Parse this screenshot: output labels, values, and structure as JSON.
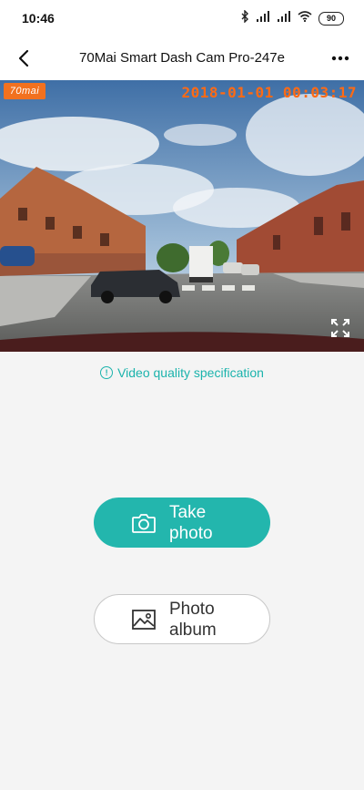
{
  "status_bar": {
    "time": "10:46",
    "battery": "90",
    "icons": [
      "bluetooth-icon",
      "signal-icon",
      "signal-icon",
      "wifi-icon",
      "battery-icon"
    ]
  },
  "nav": {
    "title": "70Mai Smart Dash Cam Pro-247e",
    "back_icon": "back-arrow-icon",
    "more_icon": "more-dots-icon"
  },
  "video": {
    "brand": "70mai",
    "timestamp": "2018-01-01 00:03:17",
    "fullscreen_icon": "fullscreen-icon"
  },
  "quality_link": {
    "label": "Video quality specification",
    "icon": "info-icon",
    "color": "#1bb3ac"
  },
  "actions": {
    "take_photo_label": "Take\nphoto",
    "take_photo_icon": "camera-icon",
    "photo_album_label": "Photo\nalbum",
    "photo_album_icon": "image-icon"
  },
  "colors": {
    "accent": "#23b6ad",
    "timestamp": "#ff6a14",
    "brand": "#f2711f"
  }
}
